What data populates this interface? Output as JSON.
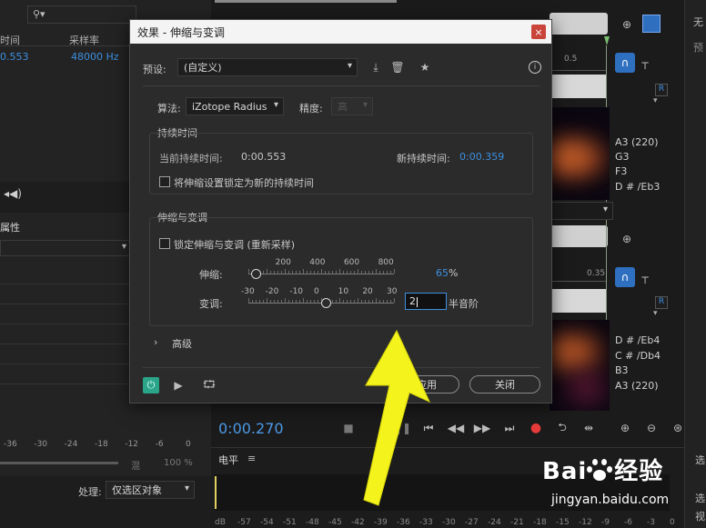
{
  "files_panel": {
    "search_icon": "search-icon",
    "col_duration": "时间",
    "col_samplerate": "采样率",
    "row_duration": "0.553",
    "row_samplerate": "48000 Hz"
  },
  "properties_panel": {
    "title": "属性"
  },
  "mixer_ruler": [
    "-36",
    "-30",
    "-24",
    "-18",
    "-12",
    "-6",
    "0"
  ],
  "mixer_percent": "100 %",
  "mixer_wet": "混",
  "process": {
    "label": "处理:",
    "value": "仅选区对象"
  },
  "editor": {
    "time_display": "0:00.270",
    "ruler_top_value": "0.5",
    "ruler_bottom_value": "0.35",
    "channel_badge": "R",
    "notes_top": [
      "A3 (220)",
      "G3",
      "F3",
      "D # /Eb3"
    ],
    "notes_bottom": [
      "D # /Eb4",
      "C # /Db4",
      "B3",
      "A3 (220)"
    ],
    "right_edge_top": "无",
    "right_edge_preset": "预"
  },
  "level_panel": {
    "title": "电平",
    "db_ticks": [
      "dB",
      "-57",
      "-54",
      "-51",
      "-48",
      "-45",
      "-42",
      "-39",
      "-36",
      "-33",
      "-30",
      "-27",
      "-24",
      "-21",
      "-18",
      "-15",
      "-12",
      "-9",
      "-6",
      "-3",
      "0"
    ],
    "right_label1": "选",
    "right_label2": "选",
    "right_label3": "视"
  },
  "dialog": {
    "title": "效果 - 伸缩与变调",
    "preset_label": "预设:",
    "preset_value": "(自定义)",
    "algorithm_label": "算法:",
    "algorithm_value": "iZotope Radius",
    "precision_label": "精度:",
    "precision_value": "高",
    "duration_group": "持续时间",
    "current_duration_label": "当前持续时间:",
    "current_duration_value": "0:00.553",
    "new_duration_label": "新持续时间:",
    "new_duration_value": "0:00.359",
    "lock_duration_label": "将伸缩设置锁定为新的持续时间",
    "stretch_group": "伸缩与变调",
    "lock_stretch_label": "锁定伸缩与变调 (重新采样)",
    "stretch_label": "伸缩:",
    "stretch_ticks": [
      "200",
      "400",
      "600",
      "800"
    ],
    "stretch_value": "65",
    "stretch_unit": "%",
    "stretch_level": 0.05,
    "pitch_label": "变调:",
    "pitch_ticks": [
      "-30",
      "-20",
      "-10",
      "0",
      "10",
      "20",
      "30"
    ],
    "pitch_value": "2",
    "pitch_unit": "半音阶",
    "pitch_level": 0.53,
    "advanced_label": "高级",
    "apply_label": "应用",
    "close_label": "关闭"
  },
  "watermark": {
    "brand": "Baidu经验",
    "url": "jingyan.baidu.com"
  },
  "colors": {
    "accent": "#3d8fe0",
    "arrow": "#f5f31c",
    "power": "#2aa58a",
    "record": "#e83b3b"
  }
}
